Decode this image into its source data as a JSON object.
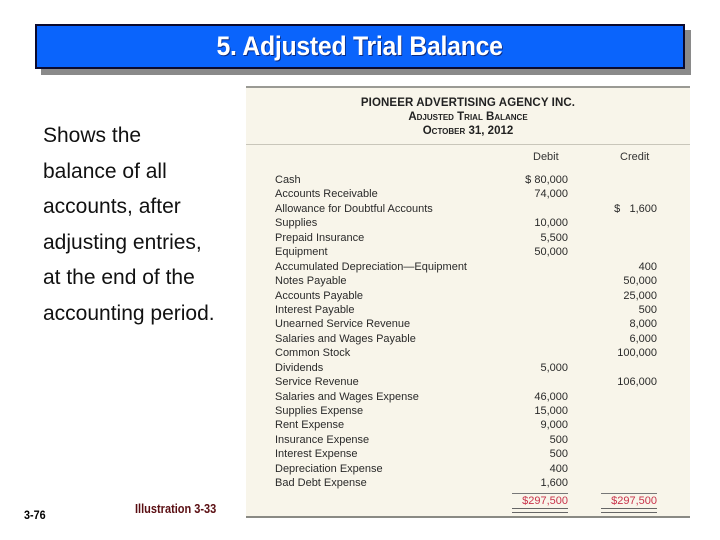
{
  "slide": {
    "title": "5. Adjusted Trial Balance",
    "description_lines": [
      "Shows the",
      "balance of all",
      "accounts, after",
      "adjusting entries,",
      "at the end of the",
      "accounting period."
    ],
    "slide_number": "3-76",
    "illustration_label": "Illustration 3-33"
  },
  "colors": {
    "title_bg": "#0a64fc",
    "title_text": "#ffffff",
    "illustration_label": "#5a0e12",
    "totals": "#c8324a",
    "panel_bg": "#f8f5ea"
  },
  "trial_balance": {
    "company": "PIONEER ADVERTISING AGENCY INC.",
    "title": "Adjusted Trial Balance",
    "date": "October 31, 2012",
    "columns": {
      "debit": "Debit",
      "credit": "Credit"
    },
    "rows": [
      {
        "account": "Cash",
        "debit": "$ 80,000",
        "credit": ""
      },
      {
        "account": "Accounts Receivable",
        "debit": "74,000",
        "credit": ""
      },
      {
        "account": "Allowance for Doubtful Accounts",
        "debit": "",
        "credit": "$   1,600"
      },
      {
        "account": "Supplies",
        "debit": "10,000",
        "credit": ""
      },
      {
        "account": "Prepaid Insurance",
        "debit": "5,500",
        "credit": ""
      },
      {
        "account": "Equipment",
        "debit": "50,000",
        "credit": ""
      },
      {
        "account": "Accumulated Depreciation—Equipment",
        "debit": "",
        "credit": "400"
      },
      {
        "account": "Notes Payable",
        "debit": "",
        "credit": "50,000"
      },
      {
        "account": "Accounts Payable",
        "debit": "",
        "credit": "25,000"
      },
      {
        "account": "Interest Payable",
        "debit": "",
        "credit": "500"
      },
      {
        "account": "Unearned Service Revenue",
        "debit": "",
        "credit": "8,000"
      },
      {
        "account": "Salaries and Wages Payable",
        "debit": "",
        "credit": "6,000"
      },
      {
        "account": "Common Stock",
        "debit": "",
        "credit": "100,000"
      },
      {
        "account": "Dividends",
        "debit": "5,000",
        "credit": ""
      },
      {
        "account": "Service Revenue",
        "debit": "",
        "credit": "106,000"
      },
      {
        "account": "Salaries and Wages Expense",
        "debit": "46,000",
        "credit": ""
      },
      {
        "account": "Supplies Expense",
        "debit": "15,000",
        "credit": ""
      },
      {
        "account": "Rent Expense",
        "debit": "9,000",
        "credit": ""
      },
      {
        "account": "Insurance Expense",
        "debit": "500",
        "credit": ""
      },
      {
        "account": "Interest Expense",
        "debit": "500",
        "credit": ""
      },
      {
        "account": "Depreciation Expense",
        "debit": "400",
        "credit": ""
      },
      {
        "account": "Bad Debt Expense",
        "debit": "1,600",
        "credit": ""
      }
    ],
    "totals": {
      "debit": "$297,500",
      "credit": "$297,500"
    }
  }
}
